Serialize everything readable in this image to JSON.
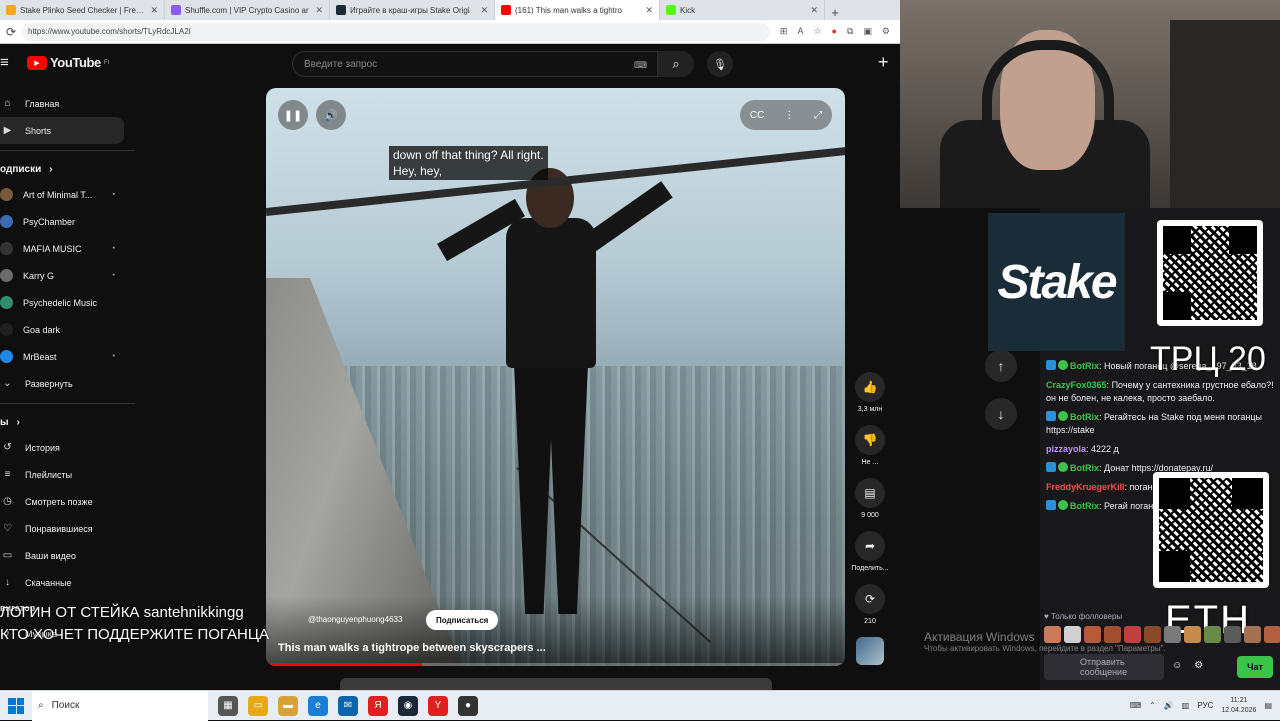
{
  "browser": {
    "tabs": [
      {
        "title": "Stake Plinko Seed Checker | Free P",
        "color": "#f5a623",
        "active": false
      },
      {
        "title": "Shuffle.com | VIP Crypto Casino ar",
        "color": "#8a5cf6",
        "active": false
      },
      {
        "title": "Играйте в краш-игры Stake Origi",
        "color": "#1a2c38",
        "active": false
      },
      {
        "title": "(161) This man walks a tightro",
        "color": "#ff0000",
        "active": true
      },
      {
        "title": "Kick",
        "color": "#53fc18",
        "active": false
      }
    ],
    "url": "https://www.youtube.com/shorts/TLyRdcJLA2I"
  },
  "youtube": {
    "logo_text": "YouTube",
    "region": "FI",
    "search_placeholder": "Введите запрос",
    "sidebar": {
      "main": [
        {
          "label": "Главная",
          "icon": "home-icon",
          "glyph": "⌂"
        },
        {
          "label": "Shorts",
          "icon": "shorts-icon",
          "glyph": "▶",
          "selected": true
        }
      ],
      "subs_title": "одписки",
      "subscriptions": [
        {
          "label": "Art of Minimal T...",
          "color": "#7b5a3a",
          "dot": "▪"
        },
        {
          "label": "PsyChamber",
          "color": "#3b6bb0",
          "dot": ""
        },
        {
          "label": "MAFIA MUSIC",
          "color": "#333333",
          "dot": "•"
        },
        {
          "label": "Karry G",
          "color": "#6a6a6a",
          "dot": "•"
        },
        {
          "label": "Psychedelic Music",
          "color": "#2d8f6f",
          "dot": ""
        },
        {
          "label": "Goa dark",
          "color": "#202020",
          "dot": ""
        },
        {
          "label": "MrBeast",
          "color": "#1e88e5",
          "dot": "•"
        },
        {
          "label": "Развернуть",
          "color": "",
          "dot": ""
        }
      ],
      "you_title": "ы",
      "you": [
        {
          "label": "История",
          "glyph": "↺"
        },
        {
          "label": "Плейлисты",
          "glyph": "≡"
        },
        {
          "label": "Смотреть позже",
          "glyph": "◷"
        },
        {
          "label": "Понравившиеся",
          "glyph": "♡"
        },
        {
          "label": "Ваши видео",
          "glyph": "▭"
        },
        {
          "label": "Скачанные",
          "glyph": "↓"
        }
      ],
      "nav_title": "вигатор",
      "nav": [
        {
          "label": "Музыка",
          "glyph": "♪"
        }
      ]
    },
    "video": {
      "captions": [
        "down off that thing? All right.",
        "Hey, hey,"
      ],
      "channel": "@thaonguyenphuong4633",
      "subscribe": "Подписаться",
      "title": "This man walks a tightrope between skyscrapers ...",
      "progress": 0.27
    },
    "actions": [
      {
        "icon": "like-icon",
        "glyph": "👍",
        "label": "3,3 млн"
      },
      {
        "icon": "dislike-icon",
        "glyph": "👎",
        "label": "Не ..."
      },
      {
        "icon": "comments-icon",
        "glyph": "▤",
        "label": "9 000"
      },
      {
        "icon": "share-icon",
        "glyph": "➦",
        "label": "Поделить..."
      },
      {
        "icon": "remix-icon",
        "glyph": "⟳",
        "label": "210"
      }
    ]
  },
  "stream": {
    "stake_logo": "Stake",
    "trc": "ТРЦ 20",
    "eth": "ETH",
    "overlay_line1": "ЛОГИН ОТ СТЕЙКА santehnikkingg",
    "overlay_line2": "КТО ХОЧЕТ ПОДДЕРЖИТЕ ПОГАНЦА",
    "chat": [
      {
        "user": "BotRix",
        "ucolor": "#3ac54a",
        "text": "Новый поганец @serega_197_93_18",
        "badges": true
      },
      {
        "user": "CrazyFox0365",
        "ucolor": "#3ac54a",
        "text": "Почему у сантехника грустное ебало?! он не болен, не калека, просто заебало.",
        "badges": false
      },
      {
        "user": "BotRix",
        "ucolor": "#3ac54a",
        "text": "Регайтесь на Stake под меня поганцы https://stake",
        "badges": true
      },
      {
        "user": "pizzayola",
        "ucolor": "#bf94ff",
        "text": "4222 д",
        "badges": false
      },
      {
        "user": "BotRix",
        "ucolor": "#3ac54a",
        "text": "Донат https://donatepay.ru/",
        "badges": true
      },
      {
        "user": "FreddyKruegerKill",
        "ucolor": "#ff4a4a",
        "text": "поганцы",
        "badges": false
      },
      {
        "user": "BotRix",
        "ucolor": "#3ac54a",
        "text": "Регай поганцы https://stake",
        "badges": true
      }
    ],
    "followers_only": "♥ Только фолловеры",
    "chat_placeholder": "Отправить сообщение",
    "chat_button": "Чат"
  },
  "windows": {
    "activation_title": "Активация Windows",
    "activation_sub": "Чтобы активировать Windows, перейдите в раздел \"Параметры\".",
    "search": "Поиск",
    "lang": "РУС",
    "time": "11:21",
    "date": "12.04.2026"
  }
}
